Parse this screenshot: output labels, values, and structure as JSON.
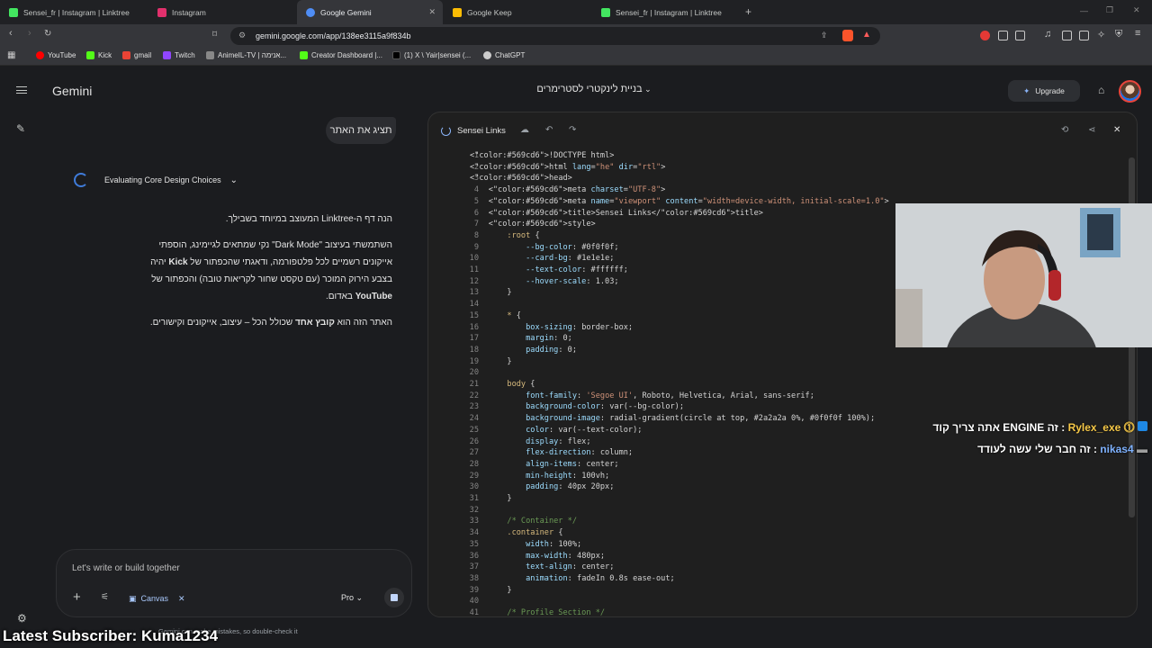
{
  "browser": {
    "tabs": [
      {
        "title": "Sensei_fr | Instagram | Linktree",
        "color": "#43e660"
      },
      {
        "title": "Instagram",
        "color": "#e1306c"
      },
      {
        "title": "Google Gemini",
        "color": "#4f8df5"
      },
      {
        "title": "Google Keep",
        "color": "#fbbc04"
      },
      {
        "title": "Sensei_fr | Instagram | Linktree",
        "color": "#43e660"
      }
    ],
    "url": "gemini.google.com/app/138ee3115a9f834b",
    "bookmarks": [
      {
        "label": "YouTube",
        "color": "#ff0000"
      },
      {
        "label": "Kick",
        "color": "#53fc18"
      },
      {
        "label": "gmail",
        "color": "#ea4335"
      },
      {
        "label": "Twitch",
        "color": "#9146ff"
      },
      {
        "label": "AnimeIL-TV | אנימה...",
        "color": "#888888"
      },
      {
        "label": "Creator Dashboard |...",
        "color": "#53fc18"
      },
      {
        "label": "(1) X \\ Yair|sensei (...",
        "color": "#111111"
      },
      {
        "label": "ChatGPT",
        "color": "#cccccc"
      }
    ]
  },
  "app": {
    "brand": "Gemini",
    "conversation_title": "בניית לינקטרי לסטרימרים",
    "upgrade_label": "Upgrade",
    "user_message": "תציג את האתר",
    "thinking_label": "Evaluating Core Design Choices",
    "answer": {
      "p1": "הנה דף ה-Linktree המעוצב במיוחד בשבילך.",
      "p2_l1": "השתמשתי בעיצוב \"Dark Mode\" נקי שמתאים לגיימינג, הוספתי",
      "p2_l2a": "אייקונים רשמיים לכל פלטפורמה, ודאגתי שהכפתור של ",
      "p2_l2b": "Kick",
      "p2_l2c": " יהיה",
      "p2_l3": "בצבע הירוק המוכר (עם טקסט שחור לקריאות טובה) והכפתור של",
      "p2_l4a": "YouTube",
      "p2_l4b": " באדום.",
      "p3a": "האתר הזה הוא ",
      "p3b": "קובץ אחד",
      "p3c": " שכולל הכל – עיצוב, אייקונים וקישורים."
    },
    "prompt_placeholder": "Let's write or build together",
    "canvas_chip": "Canvas",
    "model": "Pro",
    "disclaimer": "Gemini can make mistakes, so double-check it"
  },
  "canvas": {
    "title": "Sensei Links",
    "lines": [
      {
        "n": "1",
        "t": "<!DOCTYPE html>"
      },
      {
        "n": "2",
        "t": "<html lang=\"he\" dir=\"rtl\">"
      },
      {
        "n": "3",
        "t": "<head>"
      },
      {
        "n": "4",
        "t": "    <meta charset=\"UTF-8\">"
      },
      {
        "n": "5",
        "t": "    <meta name=\"viewport\" content=\"width=device-width, initial-scale=1.0\">"
      },
      {
        "n": "6",
        "t": "    <title>Sensei Links</title>"
      },
      {
        "n": "7",
        "t": "    <style>"
      },
      {
        "n": "8",
        "t": "        :root {"
      },
      {
        "n": "9",
        "t": "            --bg-color: #0f0f0f;"
      },
      {
        "n": "10",
        "t": "            --card-bg: #1e1e1e;"
      },
      {
        "n": "11",
        "t": "            --text-color: #ffffff;"
      },
      {
        "n": "12",
        "t": "            --hover-scale: 1.03;"
      },
      {
        "n": "13",
        "t": "        }"
      },
      {
        "n": "14",
        "t": ""
      },
      {
        "n": "15",
        "t": "        * {"
      },
      {
        "n": "16",
        "t": "            box-sizing: border-box;"
      },
      {
        "n": "17",
        "t": "            margin: 0;"
      },
      {
        "n": "18",
        "t": "            padding: 0;"
      },
      {
        "n": "19",
        "t": "        }"
      },
      {
        "n": "20",
        "t": ""
      },
      {
        "n": "21",
        "t": "        body {"
      },
      {
        "n": "22",
        "t": "            font-family: 'Segoe UI', Roboto, Helvetica, Arial, sans-serif;"
      },
      {
        "n": "23",
        "t": "            background-color: var(--bg-color);"
      },
      {
        "n": "24",
        "t": "            background-image: radial-gradient(circle at top, #2a2a2a 0%, #0f0f0f 100%);"
      },
      {
        "n": "25",
        "t": "            color: var(--text-color);"
      },
      {
        "n": "26",
        "t": "            display: flex;"
      },
      {
        "n": "27",
        "t": "            flex-direction: column;"
      },
      {
        "n": "28",
        "t": "            align-items: center;"
      },
      {
        "n": "29",
        "t": "            min-height: 100vh;"
      },
      {
        "n": "30",
        "t": "            padding: 40px 20px;"
      },
      {
        "n": "31",
        "t": "        }"
      },
      {
        "n": "32",
        "t": ""
      },
      {
        "n": "33",
        "t": "        /* Container */"
      },
      {
        "n": "34",
        "t": "        .container {"
      },
      {
        "n": "35",
        "t": "            width: 100%;"
      },
      {
        "n": "36",
        "t": "            max-width: 480px;"
      },
      {
        "n": "37",
        "t": "            text-align: center;"
      },
      {
        "n": "38",
        "t": "            animation: fadeIn 0.8s ease-out;"
      },
      {
        "n": "39",
        "t": "        }"
      },
      {
        "n": "40",
        "t": ""
      },
      {
        "n": "41",
        "t": "        /* Profile Section */"
      }
    ]
  },
  "overlay": {
    "chat": [
      {
        "user": "Rylex_exe",
        "msg": "זה ENGINE אתה צריך קוד",
        "color": "#f7c948"
      },
      {
        "user": "nikas4",
        "msg": "זה חבר שלי עשה לעודד",
        "color": "#7fb2ff"
      }
    ],
    "latest_subscriber": "Latest Subscriber: Kuma1234"
  }
}
